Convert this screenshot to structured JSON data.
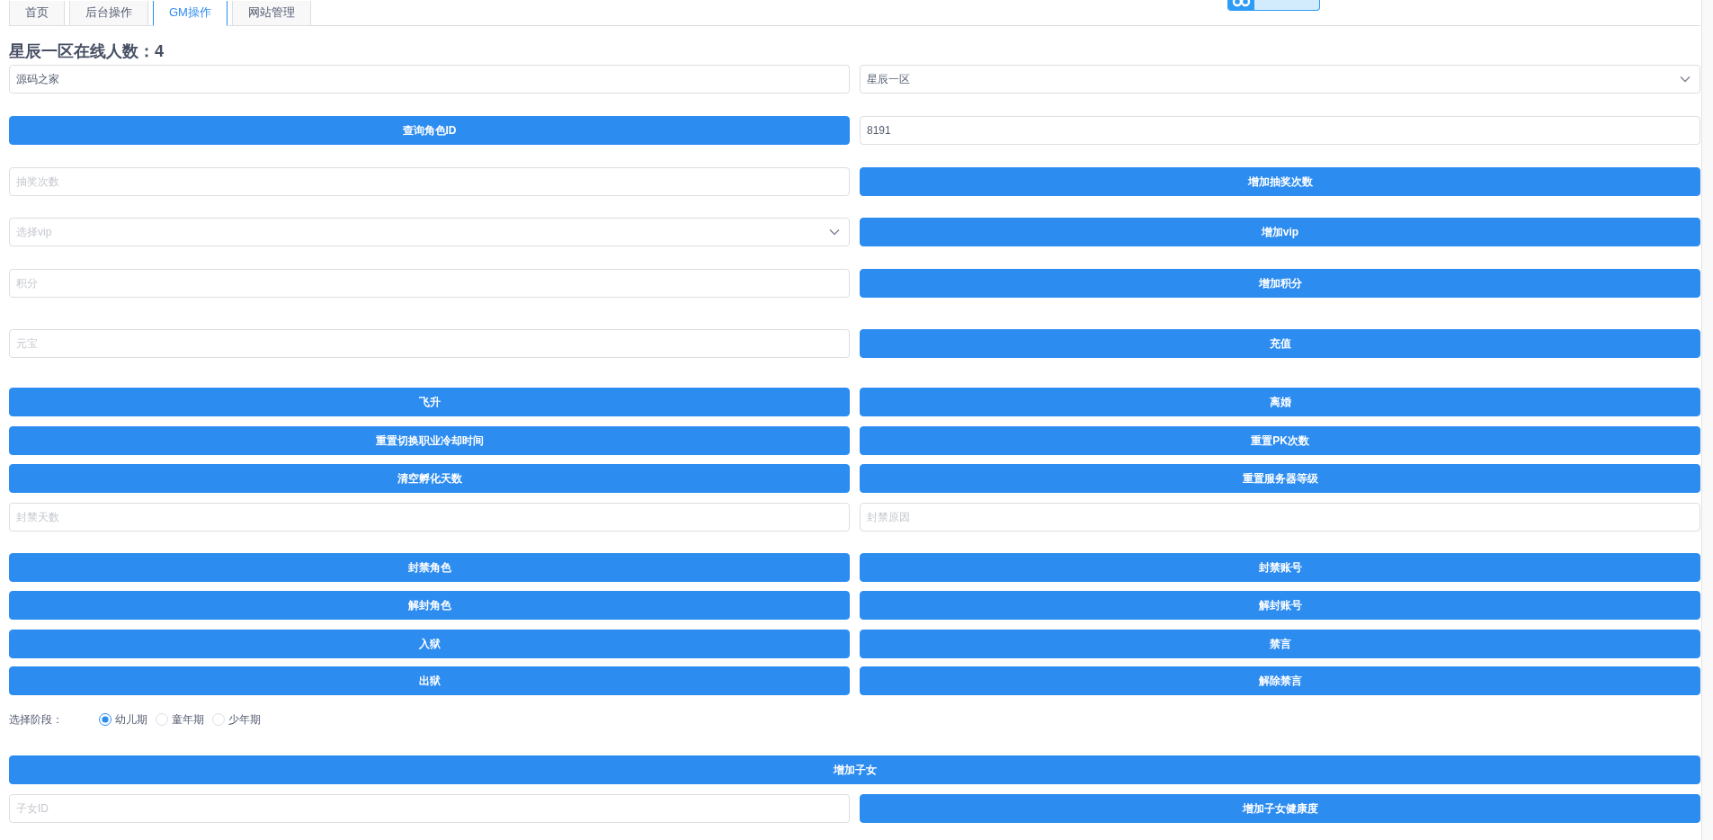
{
  "tabs": [
    {
      "label": "首页",
      "selected": false
    },
    {
      "label": "后台操作",
      "selected": false
    },
    {
      "label": "GM操作",
      "selected": true
    },
    {
      "label": "网站管理",
      "selected": false
    }
  ],
  "heading": "星辰一区在线人数：4",
  "form_rows": [
    {
      "kind": "fields",
      "items": [
        {
          "kind": "input",
          "value": "源码之家"
        },
        {
          "kind": "select",
          "value": "星辰一区"
        }
      ]
    },
    {
      "kind": "fields",
      "items": [
        {
          "kind": "button",
          "label": "查询角色ID"
        },
        {
          "kind": "input",
          "value": "8191"
        }
      ]
    },
    {
      "kind": "fields",
      "items": [
        {
          "kind": "input",
          "placeholder": "抽奖次数"
        },
        {
          "kind": "button",
          "label": "增加抽奖次数"
        }
      ]
    },
    {
      "kind": "fields",
      "items": [
        {
          "kind": "select",
          "placeholder": "选择vip"
        },
        {
          "kind": "button",
          "label": "增加vip"
        }
      ]
    },
    {
      "kind": "fields",
      "items": [
        {
          "kind": "input",
          "placeholder": "积分"
        },
        {
          "kind": "button",
          "label": "增加积分"
        }
      ]
    },
    {
      "kind": "fields",
      "items": [
        {
          "kind": "input",
          "placeholder": "元宝"
        },
        {
          "kind": "button",
          "label": "充值"
        }
      ]
    },
    {
      "kind": "fields",
      "items": [
        {
          "kind": "button",
          "label": "飞升"
        },
        {
          "kind": "button",
          "label": "离婚"
        }
      ]
    },
    {
      "kind": "fields",
      "items": [
        {
          "kind": "button",
          "label": "重置切换职业冷却时间"
        },
        {
          "kind": "button",
          "label": "重置PK次数"
        }
      ]
    },
    {
      "kind": "fields",
      "items": [
        {
          "kind": "button",
          "label": "清空孵化天数"
        },
        {
          "kind": "button",
          "label": "重置服务器等级"
        }
      ]
    },
    {
      "kind": "fields",
      "items": [
        {
          "kind": "input",
          "placeholder": "封禁天数"
        },
        {
          "kind": "input",
          "placeholder": "封禁原因"
        }
      ]
    },
    {
      "kind": "fields",
      "items": [
        {
          "kind": "button",
          "label": "封禁角色"
        },
        {
          "kind": "button",
          "label": "封禁账号"
        }
      ]
    },
    {
      "kind": "fields",
      "items": [
        {
          "kind": "button",
          "label": "解封角色"
        },
        {
          "kind": "button",
          "label": "解封账号"
        }
      ]
    },
    {
      "kind": "fields",
      "items": [
        {
          "kind": "button",
          "label": "入狱"
        },
        {
          "kind": "button",
          "label": "禁言"
        }
      ]
    },
    {
      "kind": "fields",
      "items": [
        {
          "kind": "button",
          "label": "出狱"
        },
        {
          "kind": "button",
          "label": "解除禁言"
        }
      ]
    },
    {
      "kind": "radio_group",
      "label": "选择阶段：",
      "options": [
        {
          "label": "幼儿期",
          "selected": true
        },
        {
          "label": "童年期",
          "selected": false
        },
        {
          "label": "少年期",
          "selected": false
        }
      ]
    },
    {
      "kind": "fields",
      "items": [
        {
          "kind": "button",
          "label": "增加子女"
        }
      ]
    },
    {
      "kind": "fields",
      "items": [
        {
          "kind": "input",
          "placeholder": "子女ID"
        },
        {
          "kind": "button",
          "label": "增加子女健康度"
        }
      ]
    }
  ]
}
